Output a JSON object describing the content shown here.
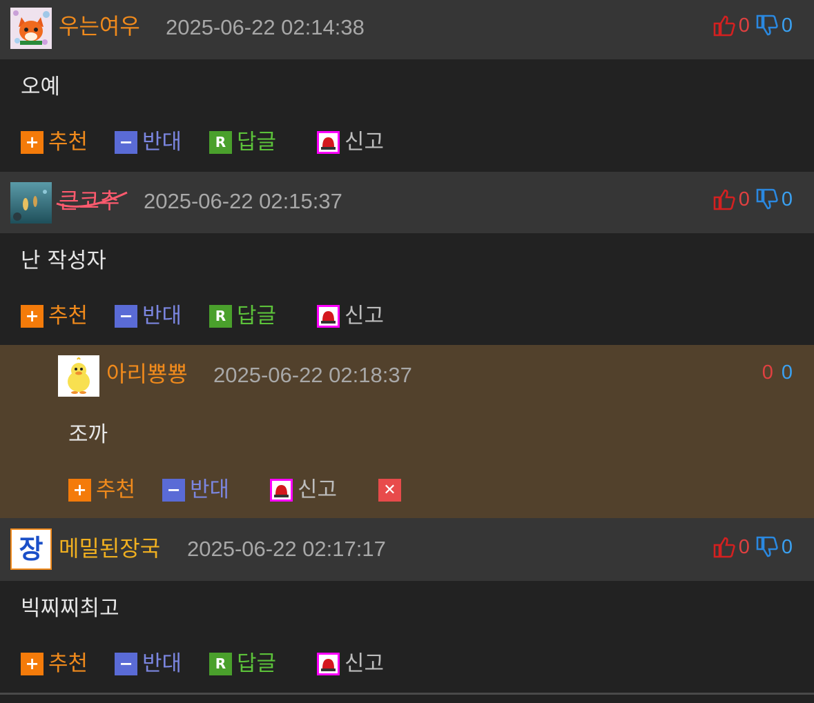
{
  "comments": [
    {
      "nickname": "우는여우",
      "nick_color": "#f08a1c",
      "date": "2025-06-22 02:14:38",
      "up": "0",
      "down": "0",
      "text": "오예",
      "avatar": "fox-avatar"
    },
    {
      "nickname": "큰코추",
      "nick_color": "#ff5a6e",
      "date": "2025-06-22 02:15:37",
      "up": "0",
      "down": "0",
      "text": "난 작성자",
      "avatar": "underwater-avatar"
    },
    {
      "nickname": "아리뿅뿅",
      "nick_color": "#f08a1c",
      "date": "2025-06-22 02:18:37",
      "up": "0",
      "down": "0",
      "text": "조까",
      "avatar": "duck-avatar",
      "is_reply": true
    },
    {
      "nickname": "메밀된장국",
      "nick_color": "#f0b020",
      "date": "2025-06-22 02:17:17",
      "up": "0",
      "down": "0",
      "text": "빅찌찌최고",
      "avatar": "jang-avatar",
      "avatar_text": "장"
    }
  ],
  "actions": {
    "recommend": "추천",
    "oppose": "반대",
    "reply": "답글",
    "report": "신고",
    "reply_icon": "R"
  },
  "colors": {
    "header_bg": "#363636",
    "body_bg": "#222222",
    "reply_bg": "#52412c",
    "up_color": "#e04040",
    "down_color": "#3aa0f0"
  }
}
